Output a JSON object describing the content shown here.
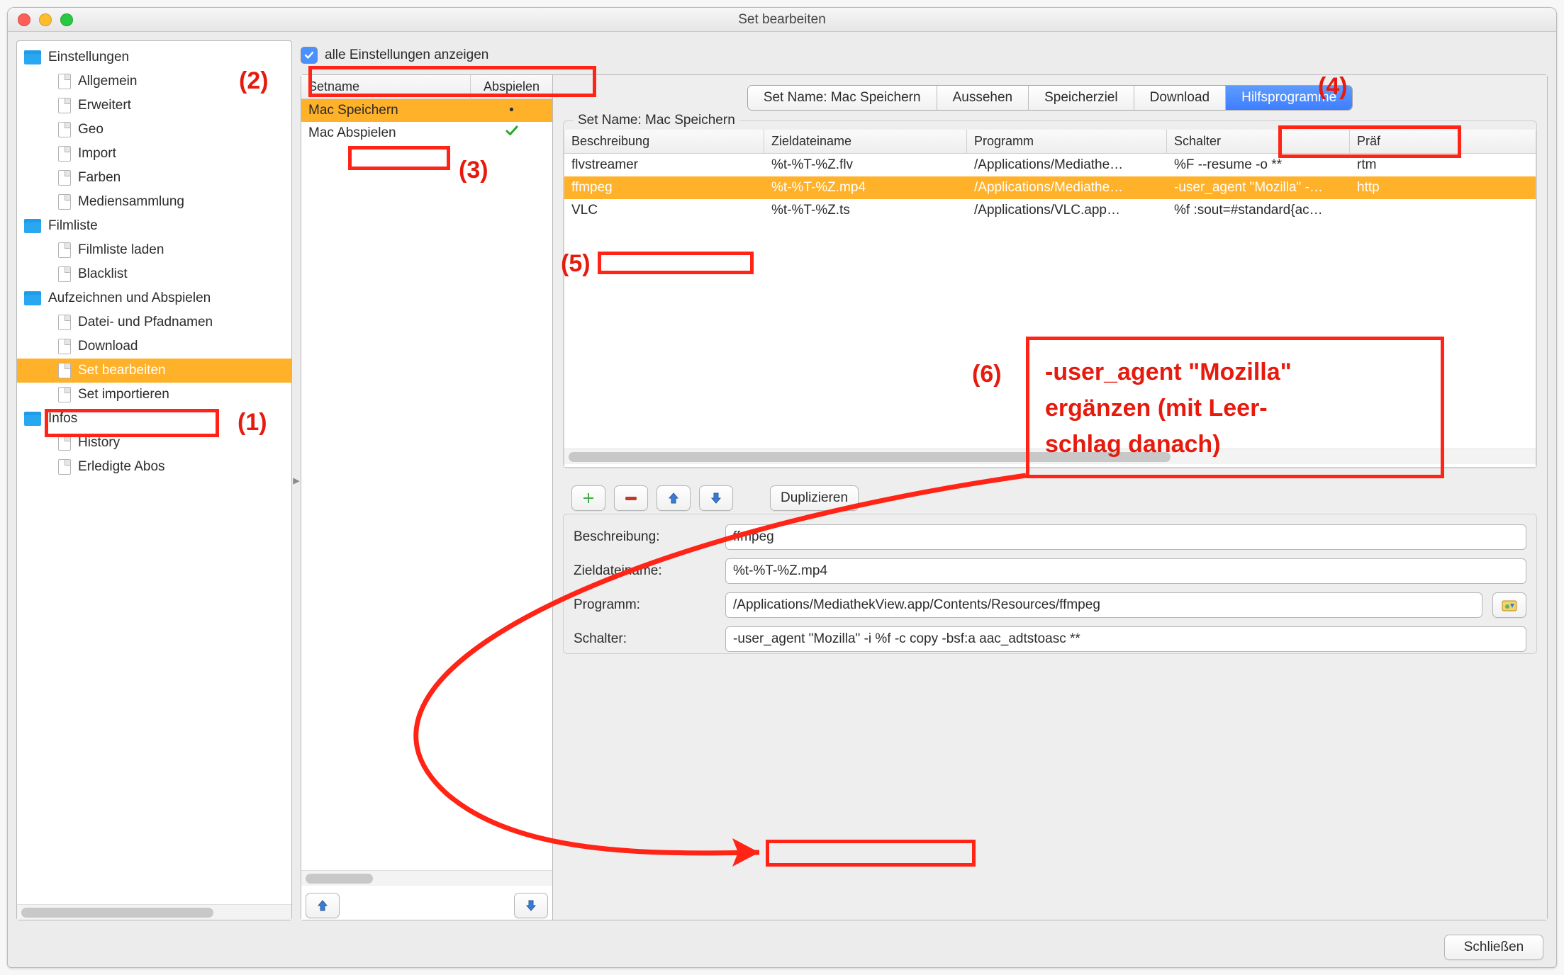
{
  "window": {
    "title": "Set bearbeiten"
  },
  "checkbox": {
    "show_all_label": "alle Einstellungen anzeigen",
    "checked": true
  },
  "sidebar": {
    "groups": [
      {
        "label": "Einstellungen",
        "children": [
          {
            "label": "Allgemein"
          },
          {
            "label": "Erweitert"
          },
          {
            "label": "Geo"
          },
          {
            "label": "Import"
          },
          {
            "label": "Farben"
          },
          {
            "label": "Mediensammlung"
          }
        ]
      },
      {
        "label": "Filmliste",
        "children": [
          {
            "label": "Filmliste laden"
          },
          {
            "label": "Blacklist"
          }
        ]
      },
      {
        "label": "Aufzeichnen und Abspielen",
        "children": [
          {
            "label": "Datei- und Pfadnamen"
          },
          {
            "label": "Download"
          },
          {
            "label": "Set bearbeiten",
            "selected": true
          },
          {
            "label": "Set importieren"
          }
        ]
      },
      {
        "label": "Infos",
        "children": [
          {
            "label": "History"
          },
          {
            "label": "Erledigte Abos"
          }
        ]
      }
    ]
  },
  "setlist": {
    "headers": {
      "name": "Setname",
      "play": "Abspielen"
    },
    "rows": [
      {
        "name": "Mac Speichern",
        "play": "•",
        "selected": true
      },
      {
        "name": "Mac Abspielen",
        "play": "✓",
        "selected": false
      }
    ]
  },
  "tabs": {
    "items": [
      {
        "label": "Set Name: Mac Speichern"
      },
      {
        "label": "Aussehen"
      },
      {
        "label": "Speicherziel"
      },
      {
        "label": "Download"
      },
      {
        "label": "Hilfsprogramme",
        "selected": true
      }
    ]
  },
  "program_table": {
    "legend": "Set Name: Mac Speichern",
    "headers": {
      "desc": "Beschreibung",
      "file": "Zieldateiname",
      "prog": "Programm",
      "sw": "Schalter",
      "prf": "Präf"
    },
    "rows": [
      {
        "desc": "flvstreamer",
        "file": "%t-%T-%Z.flv",
        "prog": "/Applications/Mediathe…",
        "sw": "%F --resume -o **",
        "prf": "rtm"
      },
      {
        "desc": "ffmpeg",
        "file": "%t-%T-%Z.mp4",
        "prog": "/Applications/Mediathe…",
        "sw": "-user_agent \"Mozilla\" -…",
        "prf": "http",
        "selected": true
      },
      {
        "desc": "VLC",
        "file": "%t-%T-%Z.ts",
        "prog": "/Applications/VLC.app…",
        "sw": "%f :sout=#standard{ac…",
        "prf": ""
      }
    ]
  },
  "prog_actions": {
    "duplicate": "Duplizieren"
  },
  "form": {
    "desc_label": "Beschreibung:",
    "desc_value": "ffmpeg",
    "file_label": "Zieldateiname:",
    "file_value": "%t-%T-%Z.mp4",
    "prog_label": "Programm:",
    "prog_value": "/Applications/MediathekView.app/Contents/Resources/ffmpeg",
    "sw_label": "Schalter:",
    "sw_value": "-user_agent \"Mozilla\" -i %f -c copy -bsf:a aac_adtstoasc **"
  },
  "footer": {
    "close": "Schließen"
  },
  "annotations": {
    "n1": "(1)",
    "n2": "(2)",
    "n3": "(3)",
    "n4": "(4)",
    "n5": "(5)",
    "n6": "(6)",
    "note_l1": "-user_agent \"Mozilla\"",
    "note_l2": "ergänzen (mit Leer-",
    "note_l3": "schlag danach)"
  }
}
